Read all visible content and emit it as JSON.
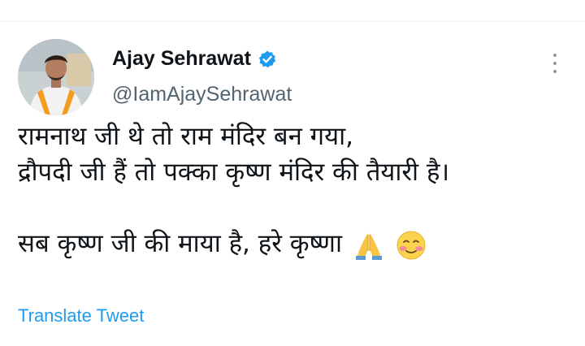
{
  "author": {
    "name": "Ajay Sehrawat",
    "handle": "@IamAjaySehrawat"
  },
  "tweet": {
    "lines": [
      "रामनाथ जी थे तो राम मंदिर बन गया,",
      "द्रौपदी जी हैं तो पक्का कृष्ण मंदिर की तैयारी है।",
      "सब कृष्ण जी की माया है, हरे कृष्णा"
    ],
    "emojis": [
      "folded-hands",
      "smiling-face-with-smiling-eyes"
    ]
  },
  "actions": {
    "translate_label": "Translate Tweet"
  },
  "colors": {
    "link": "#1d9bf0",
    "verified": "#1d9bf0",
    "secondary_text": "#536471"
  }
}
